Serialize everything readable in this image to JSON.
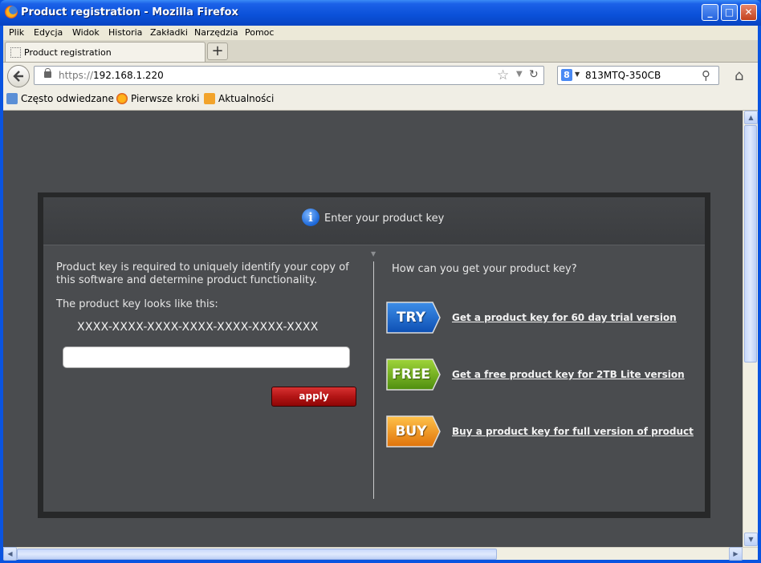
{
  "window": {
    "title": "Product registration - Mozilla Firefox",
    "btn_min": "_",
    "btn_max": "□",
    "btn_close": "✕"
  },
  "menu": [
    "Plik",
    "Edycja",
    "Widok",
    "Historia",
    "Zakładki",
    "Narzędzia",
    "Pomoc"
  ],
  "tab": {
    "label": "Product registration",
    "new_tab": "+"
  },
  "nav": {
    "url_protocol": "https://",
    "url_host": "192.168.1.220",
    "search_value": "813MTQ-350CB"
  },
  "bookmarks": [
    "Często odwiedzane",
    "Pierwsze kroki",
    "Aktualności"
  ],
  "page": {
    "header": "Enter your product key",
    "info_glyph": "i",
    "description": "Product key is required to uniquely identify your copy of this software and determine product functionality.",
    "looks_like": "The product key looks like this:",
    "pattern": "XXXX-XXXX-XXXX-XXXX-XXXX-XXXX-XXXX",
    "key_value": "",
    "apply_label": "apply",
    "howto": "How can you get your product key?",
    "options": [
      {
        "badge": "TRY",
        "link": "Get a product key for 60 day trial version",
        "color_top": "#3d8ee8",
        "color_bottom": "#0d4fb3"
      },
      {
        "badge": "FREE",
        "link": "Get a free product key for 2TB Lite version",
        "color_top": "#9fd43a",
        "color_bottom": "#4f8e0e"
      },
      {
        "badge": "BUY",
        "link": "Buy a product key for full version of product",
        "color_top": "#ffc24a",
        "color_bottom": "#e0730a"
      }
    ]
  }
}
